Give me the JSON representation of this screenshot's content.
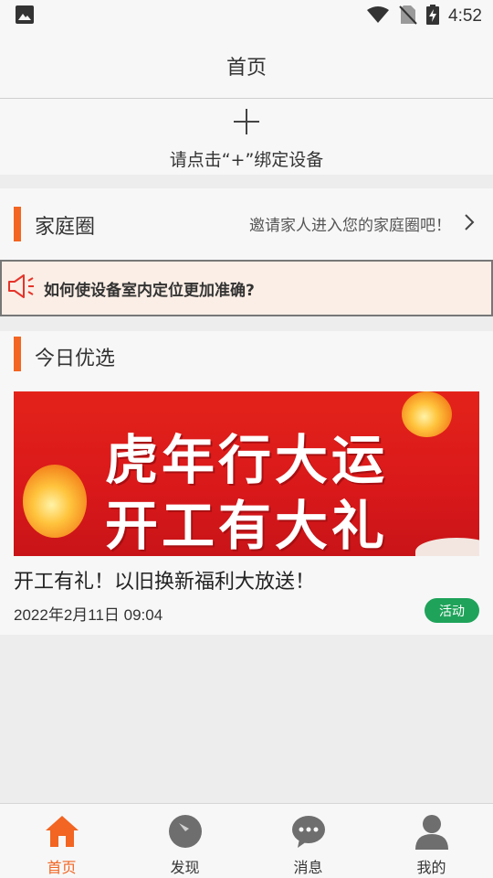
{
  "status_bar": {
    "time": "4:52",
    "icons": [
      "image-icon",
      "wifi-icon",
      "no-sim-icon",
      "battery-charging-icon"
    ]
  },
  "header": {
    "title": "首页"
  },
  "bind_device": {
    "label": "请点击“+”绑定设备",
    "icon": "plus-icon"
  },
  "family_circle": {
    "title": "家庭圈",
    "invite_text": "邀请家人进入您的家庭圈吧！",
    "icon": "chevron-right-icon"
  },
  "notice": {
    "icon": "speaker-icon",
    "text": "如何使设备室内定位更加准确?"
  },
  "today_picks": {
    "title": "今日优选",
    "banner_lines": [
      "虎年行大运",
      "开工有大礼"
    ],
    "article": {
      "title": "开工有礼！以旧换新福利大放送！",
      "date": "2022年2月11日 09:04",
      "tag": "活动"
    }
  },
  "tab_bar": {
    "tabs": [
      {
        "label": "首页",
        "icon": "home-icon",
        "active": true
      },
      {
        "label": "发现",
        "icon": "compass-icon",
        "active": false
      },
      {
        "label": "消息",
        "icon": "chat-icon",
        "active": false
      },
      {
        "label": "我的",
        "icon": "user-icon",
        "active": false
      }
    ]
  },
  "colors": {
    "accent": "#f26522",
    "tag_green": "#1fa35a",
    "banner_red": "#e3231a",
    "icon_gray": "#6e6e6e"
  }
}
